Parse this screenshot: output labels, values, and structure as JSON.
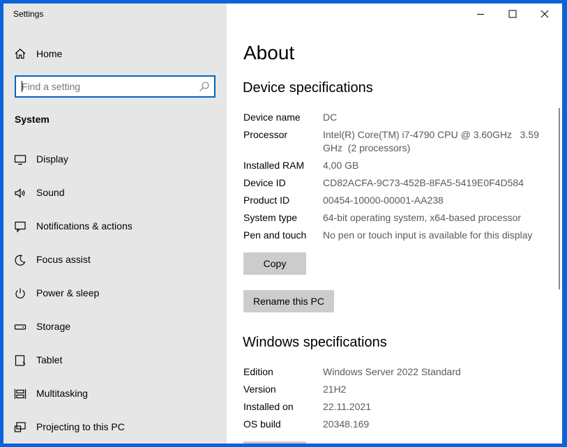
{
  "window": {
    "app_title": "Settings",
    "buttons": {
      "minimize": "minimize-icon",
      "maximize": "maximize-icon",
      "close": "close-icon"
    }
  },
  "nav": {
    "home_label": "Home",
    "search": {
      "placeholder": "Find a setting",
      "value": ""
    },
    "section_label": "System",
    "items": [
      {
        "label": "Display",
        "icon": "display-icon"
      },
      {
        "label": "Sound",
        "icon": "sound-icon"
      },
      {
        "label": "Notifications & actions",
        "icon": "notifications-icon"
      },
      {
        "label": "Focus assist",
        "icon": "focus-assist-icon"
      },
      {
        "label": "Power & sleep",
        "icon": "power-icon"
      },
      {
        "label": "Storage",
        "icon": "storage-icon"
      },
      {
        "label": "Tablet",
        "icon": "tablet-icon"
      },
      {
        "label": "Multitasking",
        "icon": "multitasking-icon"
      },
      {
        "label": "Projecting to this PC",
        "icon": "projecting-icon"
      }
    ]
  },
  "content": {
    "title": "About",
    "device_specs": {
      "heading": "Device specifications",
      "rows": [
        {
          "label": "Device name",
          "value": "DC"
        },
        {
          "label": "Processor",
          "value": "Intel(R) Core(TM) i7-4790 CPU @ 3.60GHz   3.59 GHz  (2 processors)"
        },
        {
          "label": "Installed RAM",
          "value": "4,00 GB"
        },
        {
          "label": "Device ID",
          "value": "CD82ACFA-9C73-452B-8FA5-5419E0F4D584"
        },
        {
          "label": "Product ID",
          "value": "00454-10000-00001-AA238"
        },
        {
          "label": "System type",
          "value": "64-bit operating system, x64-based processor"
        },
        {
          "label": "Pen and touch",
          "value": "No pen or touch input is available for this display"
        }
      ],
      "copy_label": "Copy",
      "rename_label": "Rename this PC"
    },
    "windows_specs": {
      "heading": "Windows specifications",
      "rows": [
        {
          "label": "Edition",
          "value": "Windows Server 2022 Standard"
        },
        {
          "label": "Version",
          "value": "21H2"
        },
        {
          "label": "Installed on",
          "value": "22.11.2021"
        },
        {
          "label": "OS build",
          "value": "20348.169"
        }
      ]
    }
  },
  "colors": {
    "desktop": "#0a64d8",
    "nav_bg": "#e6e6e6",
    "accent": "#0067c0",
    "button_bg": "#cccccc",
    "value_text": "#5a5a5a"
  }
}
